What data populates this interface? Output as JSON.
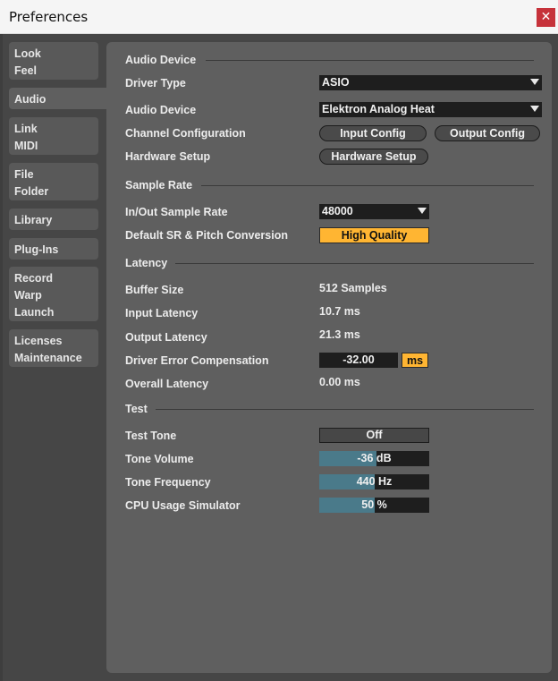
{
  "window": {
    "title": "Preferences",
    "close_glyph": "✕"
  },
  "tabs": [
    {
      "lines": [
        "Look",
        "Feel"
      ]
    },
    {
      "lines": [
        "Audio"
      ]
    },
    {
      "lines": [
        "Link",
        "MIDI"
      ]
    },
    {
      "lines": [
        "File",
        "Folder"
      ]
    },
    {
      "lines": [
        "Library"
      ]
    },
    {
      "lines": [
        "Plug-Ins"
      ]
    },
    {
      "lines": [
        "Record",
        "Warp",
        "Launch"
      ]
    },
    {
      "lines": [
        "Licenses",
        "Maintenance"
      ]
    }
  ],
  "audio_device": {
    "section": "Audio Device",
    "driver_type_label": "Driver Type",
    "driver_type_value": "ASIO",
    "audio_device_label": "Audio Device",
    "audio_device_value": "Elektron Analog Heat",
    "channel_config_label": "Channel Configuration",
    "input_config": "Input Config",
    "output_config": "Output Config",
    "hardware_setup_label": "Hardware Setup",
    "hardware_setup_button": "Hardware Setup"
  },
  "sample_rate": {
    "section": "Sample Rate",
    "io_rate_label": "In/Out Sample Rate",
    "io_rate_value": "48000",
    "conversion_label": "Default SR & Pitch Conversion",
    "conversion_value": "High Quality"
  },
  "latency": {
    "section": "Latency",
    "buffer_label": "Buffer Size",
    "buffer_value": "512 Samples",
    "input_label": "Input Latency",
    "input_value": "10.7 ms",
    "output_label": "Output Latency",
    "output_value": "21.3 ms",
    "driver_error_label": "Driver Error Compensation",
    "driver_error_value": "-32.00",
    "driver_error_unit": "ms",
    "overall_label": "Overall Latency",
    "overall_value": "0.00 ms"
  },
  "test": {
    "section": "Test",
    "tone_label": "Test Tone",
    "tone_value": "Off",
    "volume_label": "Tone Volume",
    "volume_value": "-36 dB",
    "volume_level": 0.52,
    "frequency_label": "Tone Frequency",
    "frequency_value": "440 Hz",
    "frequency_level": 0.5,
    "cpu_label": "CPU Usage Simulator",
    "cpu_value": "50 %",
    "cpu_level": 0.5
  },
  "colors": {
    "accent": "#ffb532",
    "slider_fill": "#4a7a8a",
    "close": "#c6323a"
  }
}
